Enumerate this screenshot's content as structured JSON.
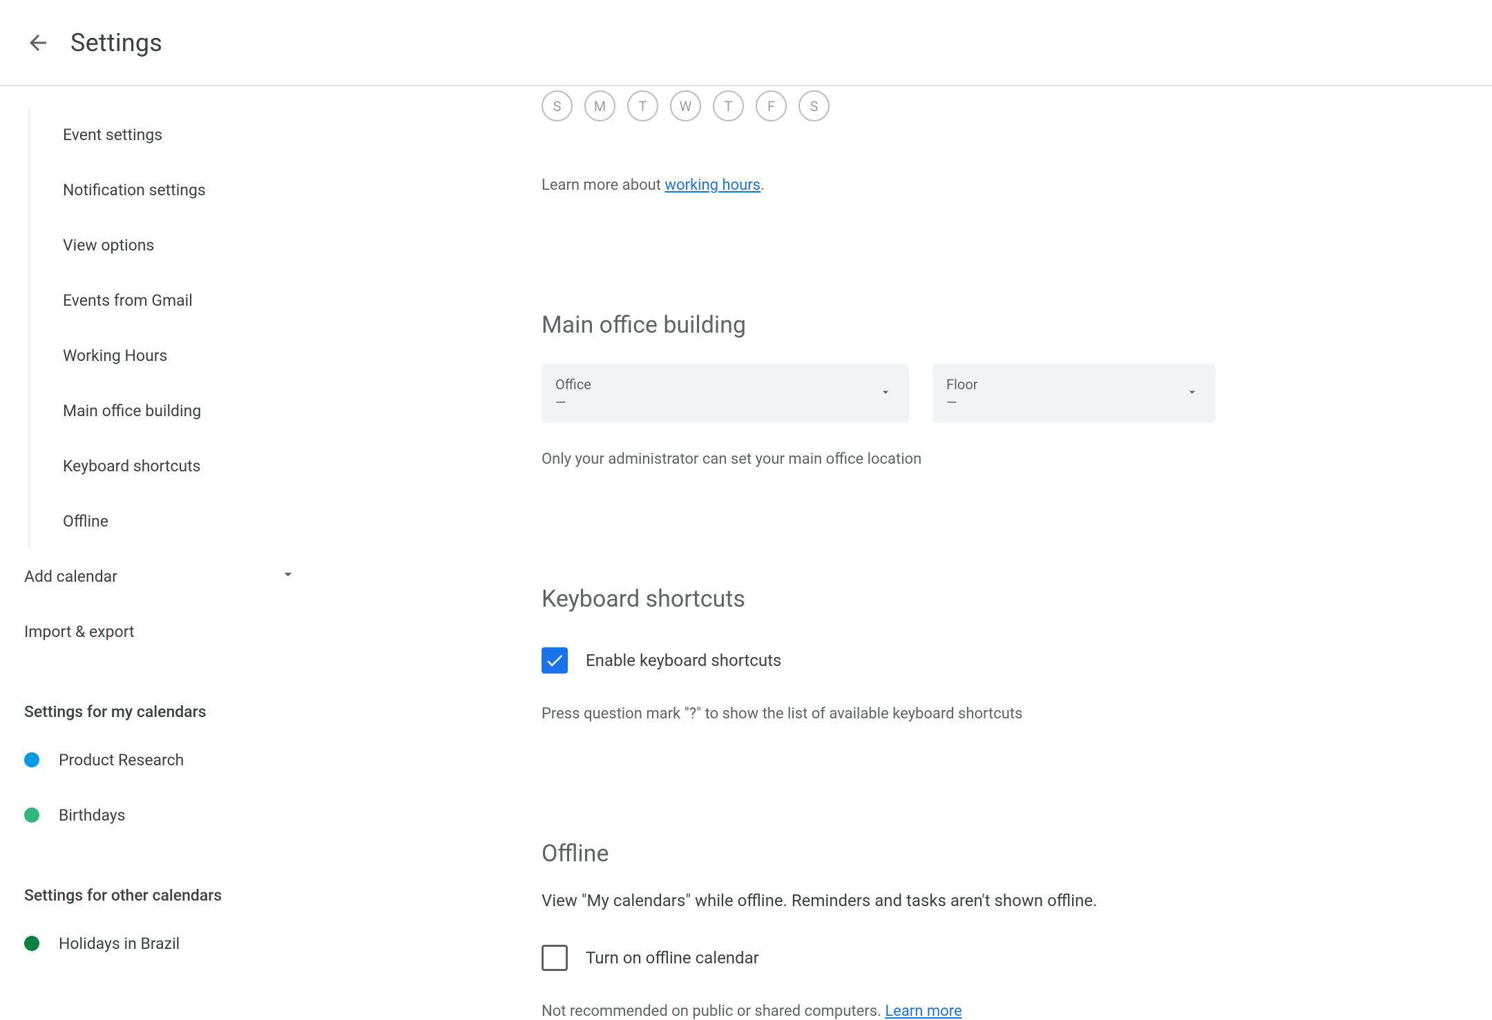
{
  "header": {
    "title": "Settings"
  },
  "sidebar": {
    "general": [
      "Event settings",
      "Notification settings",
      "View options",
      "Events from Gmail",
      "Working Hours",
      "Main office building",
      "Keyboard shortcuts",
      "Offline"
    ],
    "add_calendar": "Add calendar",
    "import_export": "Import & export",
    "my_cal_heading": "Settings for my calendars",
    "my_cals": [
      {
        "label": "Product Research",
        "color": "#039be5"
      },
      {
        "label": "Birthdays",
        "color": "#33b679"
      }
    ],
    "other_cal_heading": "Settings for other calendars",
    "other_cals": [
      {
        "label": "Holidays in Brazil",
        "color": "#0b8043"
      }
    ]
  },
  "content": {
    "days": [
      "S",
      "M",
      "T",
      "W",
      "T",
      "F",
      "S"
    ],
    "learn_prefix": "Learn more about ",
    "learn_link": "working hours",
    "learn_period": ".",
    "office_heading": "Main office building",
    "office": {
      "label": "Office",
      "value": "—"
    },
    "floor": {
      "label": "Floor",
      "value": "—"
    },
    "office_help": "Only your administrator can set your main office location",
    "kb_heading": "Keyboard shortcuts",
    "kb_checkbox_label": "Enable keyboard shortcuts",
    "kb_help": "Press question mark \"?\" to show the list of available keyboard shortcuts",
    "offline_heading": "Offline",
    "offline_sub": "View \"My calendars\" while offline. Reminders and tasks aren't shown offline.",
    "offline_checkbox_label": "Turn on offline calendar",
    "offline_help_prefix": "Not recommended on public or shared computers. ",
    "offline_help_link": "Learn more"
  }
}
